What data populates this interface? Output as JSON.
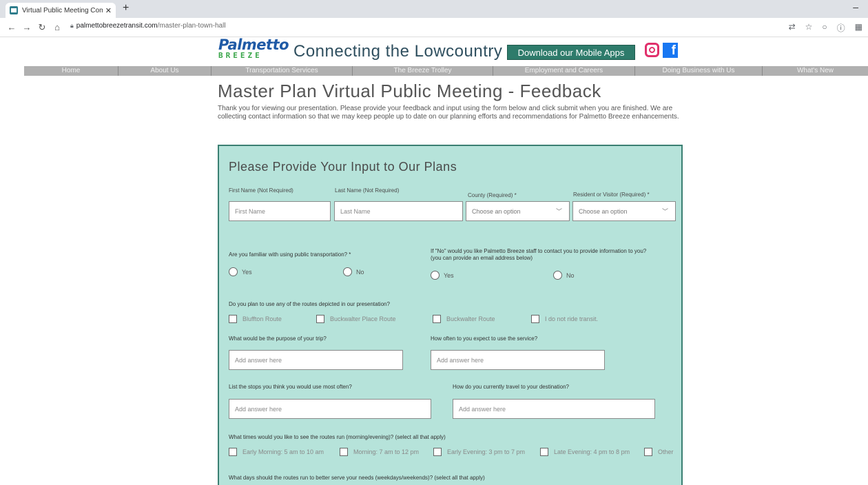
{
  "browser": {
    "tab_title": "Virtual Public Meeting Comment",
    "tab_close": "✕",
    "new_tab": "+",
    "minimize": "–",
    "url_host": "palmettobreezetransit.com",
    "url_path": "/master-plan-town-hall"
  },
  "header": {
    "logo_top": "Palmetto",
    "logo_bottom": "BREEZE",
    "tagline": "Connecting the Lowcountry",
    "download_button": "Download our Mobile Apps",
    "facebook_glyph": "f"
  },
  "nav": [
    "Home",
    "About Us",
    "Transportation Services",
    "The Breeze Trolley",
    "Employment and Careers",
    "Doing Business with Us",
    "What's New"
  ],
  "page": {
    "title": "Master Plan Virtual Public Meeting - Feedback",
    "intro": "Thank you for viewing our presentation.  Please provide your feedback and input using the form below and click submit when you are finished. We are collecting contact information so that we may keep people up to date on our planning efforts and recommendations for Palmetto Breeze enhancements."
  },
  "form": {
    "title": "Please Provide Your Input to Our Plans",
    "first_name_label": "First Name (Not Required)",
    "first_name_placeholder": "First Name",
    "last_name_label": "Last Name (Not Required)",
    "last_name_placeholder": "Last Name",
    "county_label": "County (Required) *",
    "county_value": "Choose an option",
    "resident_label": "Resident or Visitor (Required) *",
    "resident_value": "Choose an option",
    "familiar_question": "Are you familiar with using public transportation? *",
    "contact_question": "If \"No\" would you like Palmetto Breeze staff to contact you to provide information to you? (you can provide an email address below)",
    "yes": "Yes",
    "no": "No",
    "routes_question": "Do you plan to use any of the routes depicted in our presentation?",
    "routes": [
      "Bluffton Route",
      "Buckwalter Place Route",
      "Buckwalter Route",
      "I do not ride transit."
    ],
    "purpose_question": "What would be the purpose of your trip?",
    "often_question": "How often to you expect to use the service?",
    "stops_question": "List the stops you think you would use most often?",
    "travel_question": "How do you currently travel to your destination?",
    "answer_placeholder": "Add answer here",
    "times_question": "What times would you like to see the routes run (morning/evening)? (select all that apply)",
    "times": [
      "Early Morning: 5 am to 10 am",
      "Morning: 7 am to 12 pm",
      "Early Evening: 3 pm to 7 pm",
      "Late Evening: 4 pm to 8 pm",
      "Other"
    ],
    "days_question": "What days should the routes run to better serve your needs (weekdays/weekends)? (select all that apply)"
  },
  "colors": {
    "panel_bg": "#b6e3da",
    "panel_border": "#3a7f72",
    "download_bg": "#2e7b6b",
    "nav_bg": "#b0b0b0",
    "logo_blue": "#1f5aa6",
    "logo_green": "#3aa64a"
  },
  "icons": [
    "favicon",
    "back-arrow-icon",
    "forward-arrow-icon",
    "reload-icon",
    "home-icon",
    "lock-icon",
    "translate-icon",
    "star-icon",
    "extension-icon",
    "info-icon",
    "menu-icon",
    "instagram-icon",
    "facebook-icon",
    "chevron-down-icon"
  ]
}
